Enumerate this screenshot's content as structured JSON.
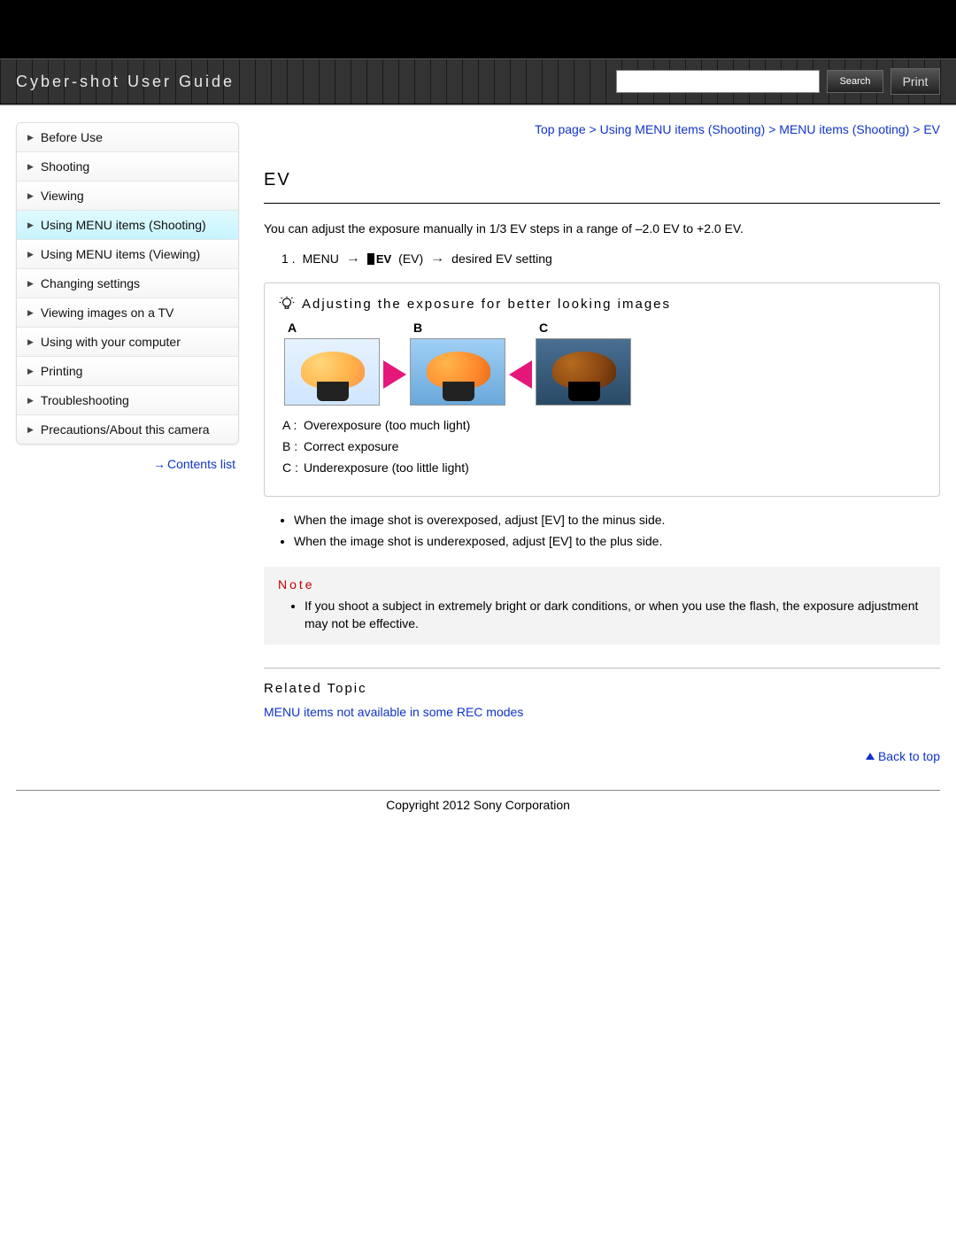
{
  "header": {
    "title": "Cyber-shot User Guide",
    "search_placeholder": "",
    "search_button": "Search",
    "print_button": "Print"
  },
  "sidebar": {
    "items": [
      {
        "label": "Before Use"
      },
      {
        "label": "Shooting"
      },
      {
        "label": "Viewing"
      },
      {
        "label": "Using MENU items (Shooting)",
        "active": true
      },
      {
        "label": "Using MENU items (Viewing)"
      },
      {
        "label": "Changing settings"
      },
      {
        "label": "Viewing images on a TV"
      },
      {
        "label": "Using with your computer"
      },
      {
        "label": "Printing"
      },
      {
        "label": "Troubleshooting"
      },
      {
        "label": "Precautions/About this camera"
      }
    ],
    "contents_link": "Contents list"
  },
  "breadcrumb": {
    "items": [
      "Top page",
      "Using MENU items (Shooting)",
      "MENU items (Shooting)",
      "EV"
    ],
    "sep": " > "
  },
  "content": {
    "title": "EV",
    "intro": "You can adjust the exposure manually in 1/3 EV steps in a range of –2.0 EV to +2.0 EV.",
    "step_num": "1 .",
    "step_menu": "MENU",
    "step_ev_icon_text": "EV",
    "step_ev_paren": "(EV)",
    "step_desired": "desired EV setting",
    "tip_title": "Adjusting the exposure for better looking images",
    "sample_labels": {
      "a": "A",
      "b": "B",
      "c": "C"
    },
    "legend": {
      "a_label": "A :",
      "a_text": "Overexposure (too much light)",
      "b_label": "B :",
      "b_text": "Correct exposure",
      "c_label": "C :",
      "c_text": "Underexposure (too little light)"
    },
    "bullets": [
      "When the image shot is overexposed, adjust [EV] to the minus side.",
      "When the image shot is underexposed, adjust [EV] to the plus side."
    ],
    "note_title": "Note",
    "note_items": [
      "If you shoot a subject in extremely bright or dark conditions, or when you use the flash, the exposure adjustment may not be effective."
    ],
    "related_title": "Related Topic",
    "related_link": "MENU items not available in some REC modes",
    "back_to_top": "Back to top"
  },
  "footer": {
    "copyright": "Copyright 2012 Sony Corporation"
  }
}
